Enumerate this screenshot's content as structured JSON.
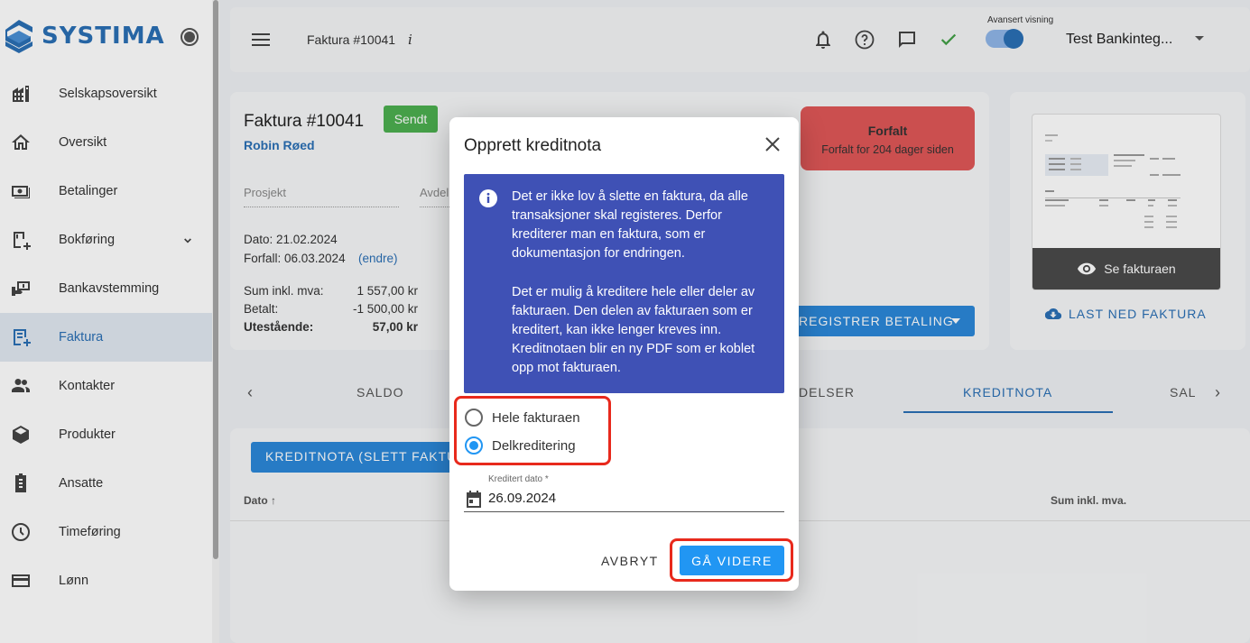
{
  "app": {
    "logo_text": "SYSTIMA"
  },
  "sidebar": {
    "items": [
      {
        "label": "Selskapsoversikt",
        "icon": "company-icon"
      },
      {
        "label": "Oversikt",
        "icon": "home-icon"
      },
      {
        "label": "Betalinger",
        "icon": "payments-icon"
      },
      {
        "label": "Bokføring",
        "icon": "bookkeeping-icon"
      },
      {
        "label": "Bankavstemming",
        "icon": "bank-reconciliation-icon"
      },
      {
        "label": "Faktura",
        "icon": "invoice-icon",
        "active": true
      },
      {
        "label": "Kontakter",
        "icon": "contacts-icon"
      },
      {
        "label": "Produkter",
        "icon": "products-icon"
      },
      {
        "label": "Ansatte",
        "icon": "employees-icon"
      },
      {
        "label": "Timeføring",
        "icon": "clock-icon"
      },
      {
        "label": "Lønn",
        "icon": "salary-icon"
      }
    ]
  },
  "topbar": {
    "breadcrumb": "Faktura #10041",
    "info_glyph": "i",
    "advanced_view_label": "Avansert visning",
    "user_name": "Test Bankinteg..."
  },
  "invoice": {
    "title": "Faktura #10041",
    "status_badge": "Sendt",
    "customer": "Robin Røed",
    "project_label": "Prosjekt",
    "department_label": "Avdel",
    "date_text": "Dato: 21.02.2024",
    "due_text": "Forfall: 06.03.2024",
    "edit_link": "(endre)",
    "sum_label": "Sum inkl. mva:",
    "sum_value": "1 557,00 kr",
    "paid_label": "Betalt:",
    "paid_value": "-1 500,00 kr",
    "outstanding_label": "Utestående:",
    "outstanding_value": "57,00 kr",
    "overdue_title": "Forfalt",
    "overdue_sub": "Forfalt for 204 dager siden",
    "register_payment": "REGISTRER BETALING",
    "preview_label": "Se fakturaen",
    "download_label": "LAST NED FAKTURA"
  },
  "tabs": {
    "saldo": "SALDO",
    "partial": "DELSER",
    "kreditnota": "KREDITNOTA",
    "sal": "SAL"
  },
  "credit_section": {
    "button_label": "KREDITNOTA (SLETT FAKTURA)",
    "col_date": "Dato",
    "col_sum": "Sum inkl. mva."
  },
  "modal": {
    "title": "Opprett kreditnota",
    "info_p1": "Det er ikke lov å slette en faktura, da alle transaksjoner skal registeres. Derfor krediterer man en faktura, som er dokumentasjon for endringen.",
    "info_p2": "Det er mulig å kreditere hele eller deler av fakturaen. Den delen av fakturaen som er kreditert, kan ikke lenger kreves inn. Kreditnotaen blir en ny PDF som er koblet opp mot fakturaen.",
    "option_full": "Hele fakturaen",
    "option_partial": "Delkreditering",
    "selected_option": "Delkreditering",
    "date_label": "Kreditert dato *",
    "date_value": "26.09.2024",
    "cancel_label": "AVBRYT",
    "next_label": "GÅ VIDERE"
  },
  "colors": {
    "brand": "#2a6fb5",
    "primary_button": "#2196f3",
    "info_box": "#3f51b5",
    "overdue": "#e05757",
    "sent_badge": "#4caf50",
    "highlight_box": "#e8291c"
  }
}
